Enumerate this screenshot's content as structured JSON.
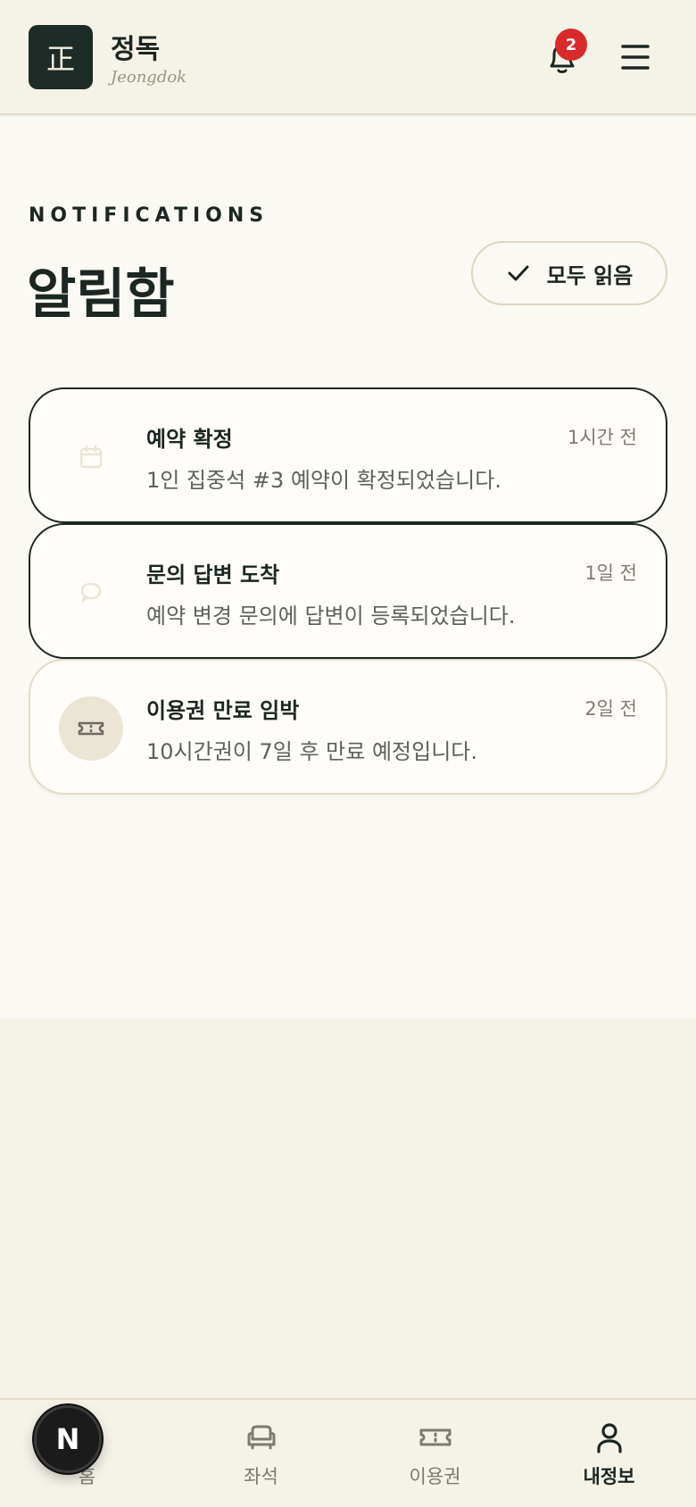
{
  "header": {
    "logo_char": "正",
    "brand_name": "정독",
    "brand_sub": "Jeongdok",
    "notification_count": "2",
    "bell_icon": "bell-icon",
    "menu_icon": "hamburger-menu-icon"
  },
  "page": {
    "eyebrow": "NOTIFICATIONS",
    "title": "알림함",
    "read_all_label": "모두 읽음",
    "read_all_icon": "check-icon"
  },
  "notifications": [
    {
      "title": "예약 확정",
      "time": "1시간 전",
      "message": "1인 집중석 #3 예약이 확정되었습니다.",
      "icon": "calendar-icon",
      "unread": true
    },
    {
      "title": "문의 답변 도착",
      "time": "1일 전",
      "message": "예약 변경 문의에 답변이 등록되었습니다.",
      "icon": "chat-bubble-icon",
      "unread": true
    },
    {
      "title": "이용권 만료 임박",
      "time": "2일 전",
      "message": "10시간권이 7일 후 만료 예정입니다.",
      "icon": "ticket-icon",
      "unread": false
    }
  ],
  "bottom_nav": {
    "items": [
      {
        "label": "홈",
        "icon": "home-icon"
      },
      {
        "label": "좌석",
        "icon": "armchair-icon"
      },
      {
        "label": "이용권",
        "icon": "ticket-icon"
      },
      {
        "label": "내정보",
        "icon": "user-icon",
        "active": true
      }
    ]
  },
  "dev_badge": "N",
  "colors": {
    "primary": "#1c2622",
    "badge": "#d9292b",
    "background": "#fbf9f3",
    "surface": "#f5f2e8",
    "border": "#e2dcc8",
    "muted": "#7d7a72"
  }
}
